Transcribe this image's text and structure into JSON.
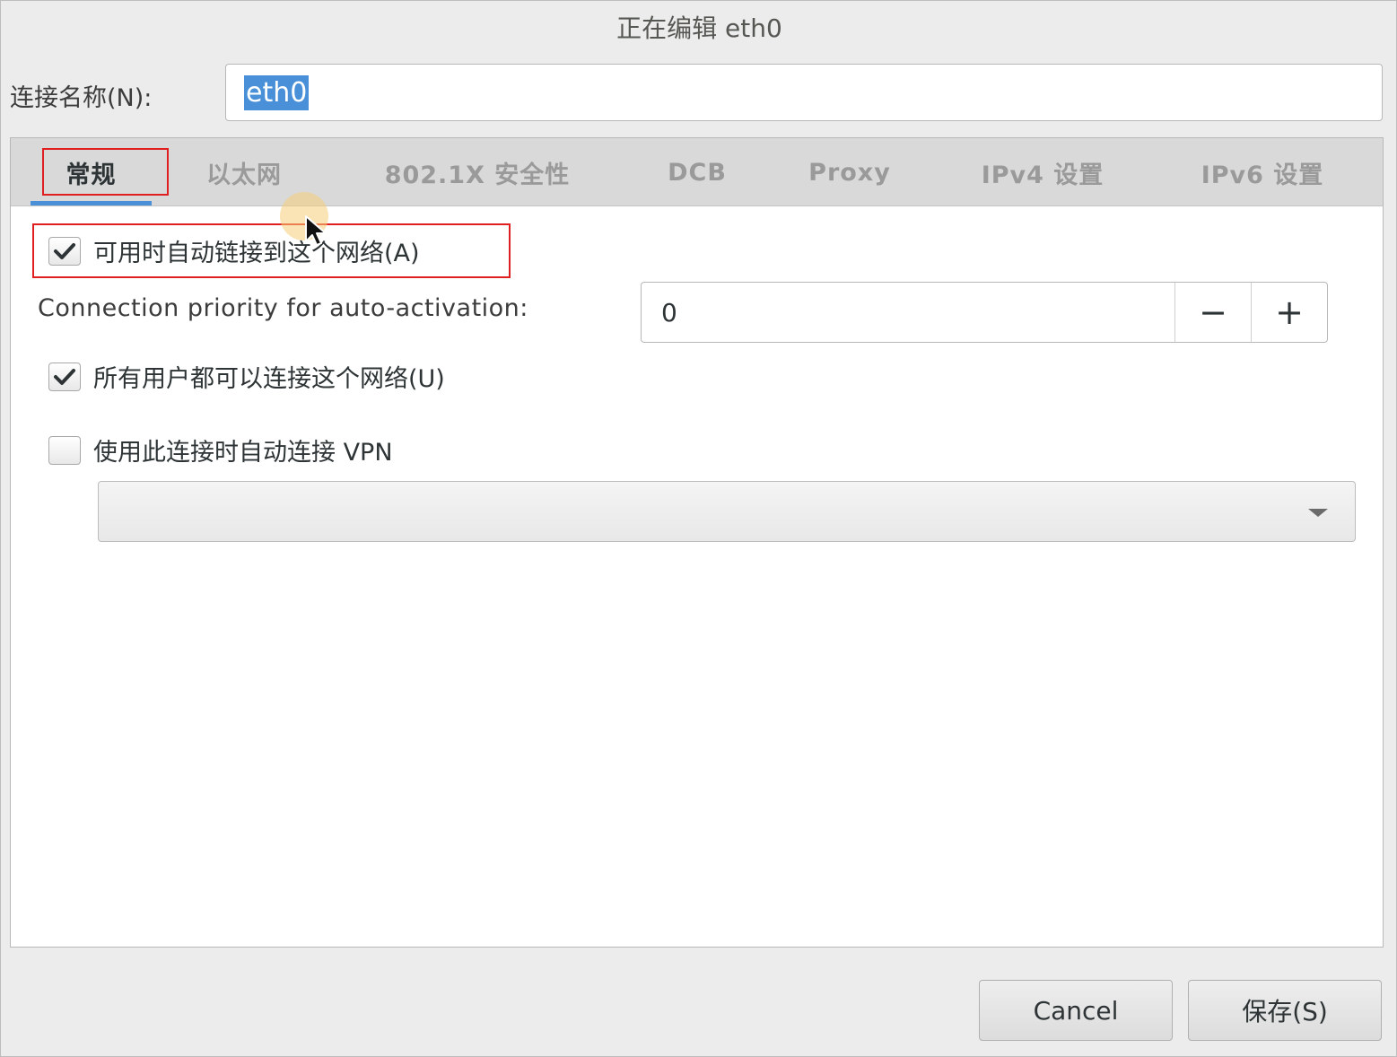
{
  "window": {
    "title": "正在编辑 eth0"
  },
  "connection_name": {
    "label": "连接名称(N):",
    "value": "eth0"
  },
  "tabs": [
    {
      "label": "常规",
      "active": true
    },
    {
      "label": "以太网",
      "active": false
    },
    {
      "label": "802.1X 安全性",
      "active": false
    },
    {
      "label": "DCB",
      "active": false
    },
    {
      "label": "Proxy",
      "active": false
    },
    {
      "label": "IPv4 设置",
      "active": false
    },
    {
      "label": "IPv6 设置",
      "active": false
    }
  ],
  "general": {
    "auto_connect": {
      "label": "可用时自动链接到这个网络(A)",
      "checked": true
    },
    "priority": {
      "label": "Connection priority for auto-activation:",
      "value": "0",
      "decrement": "−",
      "increment": "+"
    },
    "all_users": {
      "label": "所有用户都可以连接这个网络(U)",
      "checked": true
    },
    "auto_vpn": {
      "label": "使用此连接时自动连接 VPN",
      "checked": false
    },
    "vpn_select": {
      "value": ""
    }
  },
  "buttons": {
    "cancel": "Cancel",
    "save": "保存(S)"
  },
  "colors": {
    "accent": "#4a90d9",
    "highlight_box": "#e02020"
  }
}
